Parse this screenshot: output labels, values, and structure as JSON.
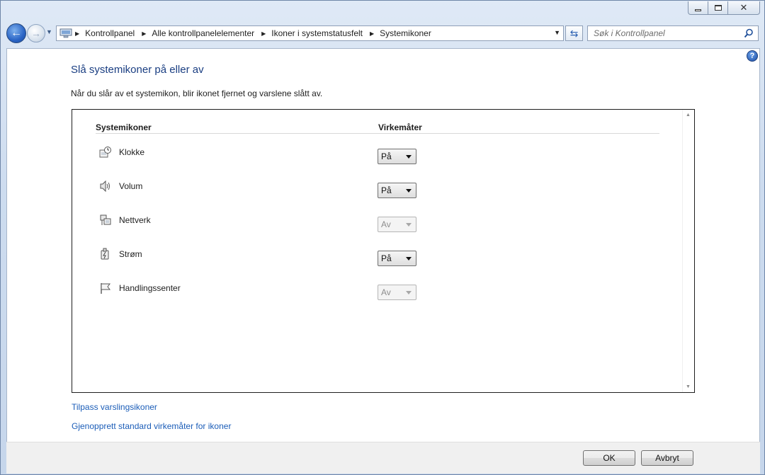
{
  "window": {
    "caption_buttons": {
      "minimize_icon": "minimize-icon",
      "maximize_icon": "maximize-icon",
      "close_icon": "close-icon"
    }
  },
  "navbar": {
    "breadcrumbs": [
      "Kontrollpanel",
      "Alle kontrollpanelelementer",
      "Ikoner i systemstatusfelt",
      "Systemikoner"
    ],
    "search_placeholder": "Søk i Kontrollpanel"
  },
  "content": {
    "help_label": "?",
    "title": "Slå systemikoner på eller av",
    "description": "Når du slår av et systemikon, blir ikonet fjernet og varslene slått av.",
    "columns": {
      "icons": "Systemikoner",
      "behaviors": "Virkemåter"
    },
    "rows": [
      {
        "label": "Klokke",
        "icon": "clock-icon",
        "value": "På",
        "enabled": true
      },
      {
        "label": "Volum",
        "icon": "speaker-icon",
        "value": "På",
        "enabled": true
      },
      {
        "label": "Nettverk",
        "icon": "network-icon",
        "value": "Av",
        "enabled": false
      },
      {
        "label": "Strøm",
        "icon": "power-icon",
        "value": "På",
        "enabled": true
      },
      {
        "label": "Handlingssenter",
        "icon": "flag-icon",
        "value": "Av",
        "enabled": false
      }
    ],
    "links": {
      "customize": "Tilpass varslingsikoner",
      "restore": "Gjenopprett standard virkemåter for ikoner"
    }
  },
  "footer": {
    "ok_label": "OK",
    "cancel_label": "Avbryt"
  }
}
